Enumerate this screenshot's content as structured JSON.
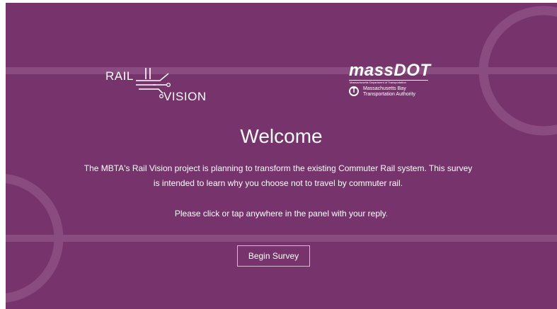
{
  "theme": {
    "panel_background": "#77336b",
    "decoration_color": "#8a4c80",
    "text_color": "#ffffff",
    "button_border": "#d7b9d1"
  },
  "logos": {
    "rail_vision": {
      "line1": "RAIL",
      "line2": "VISION"
    },
    "massdot": {
      "name": "massDOT",
      "subtitle": "Massachusetts Department of Transportation",
      "t_symbol": "T",
      "authority_line1": "Massachusetts Bay",
      "authority_line2": "Transportation Authority"
    }
  },
  "welcome": {
    "title": "Welcome",
    "intro_line1": "The MBTA's Rail Vision project is planning to transform the existing Commuter Rail system. This survey",
    "intro_line2": "is intended to learn why you choose not to travel by commuter rail.",
    "instruction": "Please click or tap anywhere in the panel with your reply."
  },
  "actions": {
    "begin_label": "Begin Survey"
  }
}
